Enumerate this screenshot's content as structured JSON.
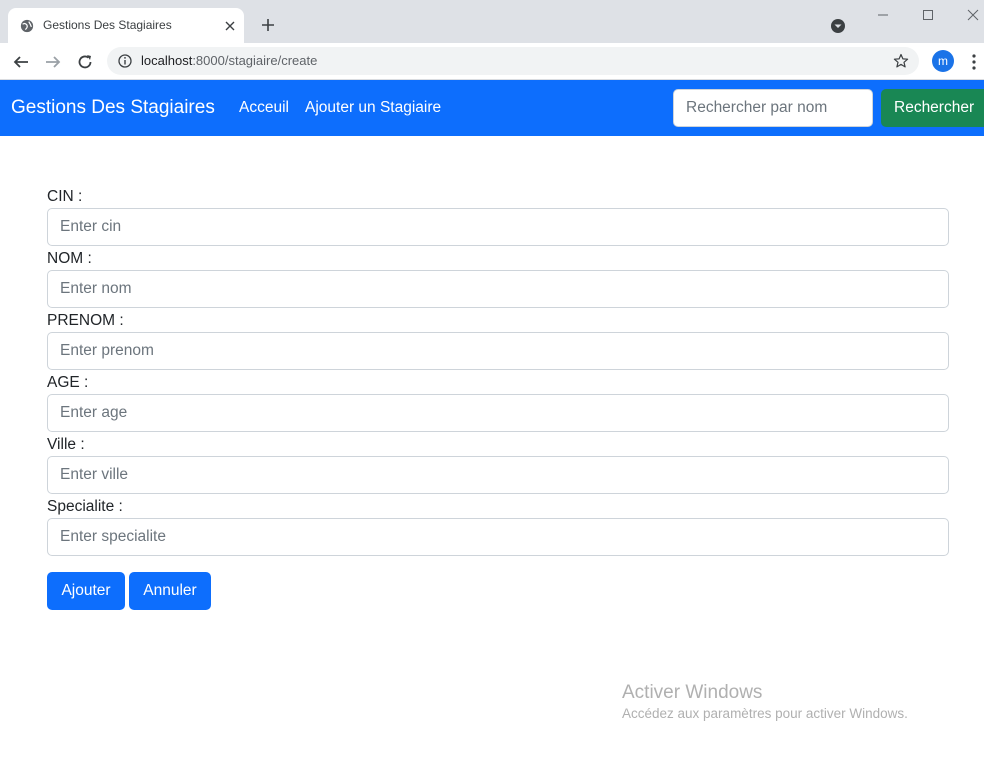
{
  "browser": {
    "tab_title": "Gestions Des Stagiaires",
    "url_host": "localhost",
    "url_rest": ":8000/stagiaire/create",
    "profile_initial": "m",
    "icons": [
      "globe-icon",
      "close-icon",
      "plus-icon",
      "tab-search-icon",
      "minimize-icon",
      "maximize-icon",
      "window-close-icon",
      "back-arrow-icon",
      "forward-arrow-icon",
      "reload-icon",
      "info-icon",
      "star-icon",
      "kebab-menu-icon"
    ]
  },
  "navbar": {
    "brand": "Gestions Des Stagiaires",
    "links": [
      "Acceuil",
      "Ajouter un Stagiaire"
    ],
    "search_placeholder": "Rechercher par nom",
    "search_button": "Rechercher",
    "color": "#0d6efd",
    "search_button_color": "#198754"
  },
  "form": {
    "fields": [
      {
        "label": "CIN :",
        "placeholder": "Enter cin"
      },
      {
        "label": "NOM :",
        "placeholder": "Enter nom"
      },
      {
        "label": "PRENOM :",
        "placeholder": "Enter prenom"
      },
      {
        "label": "AGE :",
        "placeholder": "Enter age"
      },
      {
        "label": "Ville :",
        "placeholder": "Enter ville"
      },
      {
        "label": "Specialite :",
        "placeholder": "Enter specialite"
      }
    ],
    "submit_label": "Ajouter",
    "cancel_label": "Annuler"
  },
  "watermark": {
    "title": "Activer Windows",
    "subtitle": "Accédez aux paramètres pour activer Windows."
  }
}
